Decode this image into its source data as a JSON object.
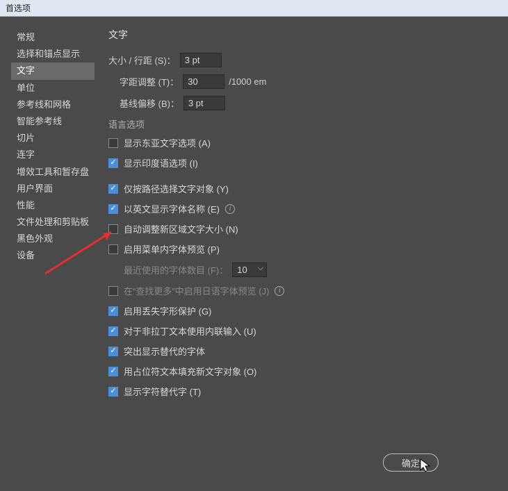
{
  "title": "首选项",
  "sidebar": {
    "items": [
      {
        "label": "常规"
      },
      {
        "label": "选择和锚点显示"
      },
      {
        "label": "文字"
      },
      {
        "label": "单位"
      },
      {
        "label": "参考线和网格"
      },
      {
        "label": "智能参考线"
      },
      {
        "label": "切片"
      },
      {
        "label": "连字"
      },
      {
        "label": "增效工具和暂存盘"
      },
      {
        "label": "用户界面"
      },
      {
        "label": "性能"
      },
      {
        "label": "文件处理和剪贴板"
      },
      {
        "label": "黑色外观"
      },
      {
        "label": "设备"
      }
    ],
    "activeIndex": 2
  },
  "content": {
    "heading": "文字",
    "fields": {
      "size_label": "大小 / 行距 (S)：",
      "size_value": "3 pt",
      "tracking_label": "字距调整 (T)：",
      "tracking_value": "30",
      "tracking_suffix": "/1000 em",
      "baseline_label": "基线偏移 (B)：",
      "baseline_value": "3 pt"
    },
    "lang_section": "语言选项",
    "checkboxes": {
      "east_asian": {
        "label": "显示东亚文字选项 (A)",
        "checked": false
      },
      "indic": {
        "label": "显示印度语选项 (I)",
        "checked": true
      },
      "path_select": {
        "label": "仅按路径选择文字对象 (Y)",
        "checked": true
      },
      "english_font": {
        "label": "以英文显示字体名称 (E)",
        "checked": true,
        "info": true
      },
      "auto_size": {
        "label": "自动调整新区域文字大小 (N)",
        "checked": false
      },
      "menu_preview": {
        "label": "启用菜单内字体预览 (P)",
        "checked": false
      },
      "recent_label": "最近使用的字体数目 (F)：",
      "recent_value": "10",
      "jp_preview": {
        "label": "在“查找更多”中启用日语字体预览 (J)",
        "checked": false,
        "info": true
      },
      "glyph_protect": {
        "label": "启用丢失字形保护 (G)",
        "checked": true
      },
      "inline_input": {
        "label": "对于非拉丁文本使用内联输入 (U)",
        "checked": true
      },
      "highlight_alt": {
        "label": "突出显示替代的字体",
        "checked": true
      },
      "placeholder": {
        "label": "用占位符文本填充新文字对象 (O)",
        "checked": true
      },
      "show_alt": {
        "label": "显示字符替代字 (T)",
        "checked": true
      }
    }
  },
  "ok_button": "确定"
}
